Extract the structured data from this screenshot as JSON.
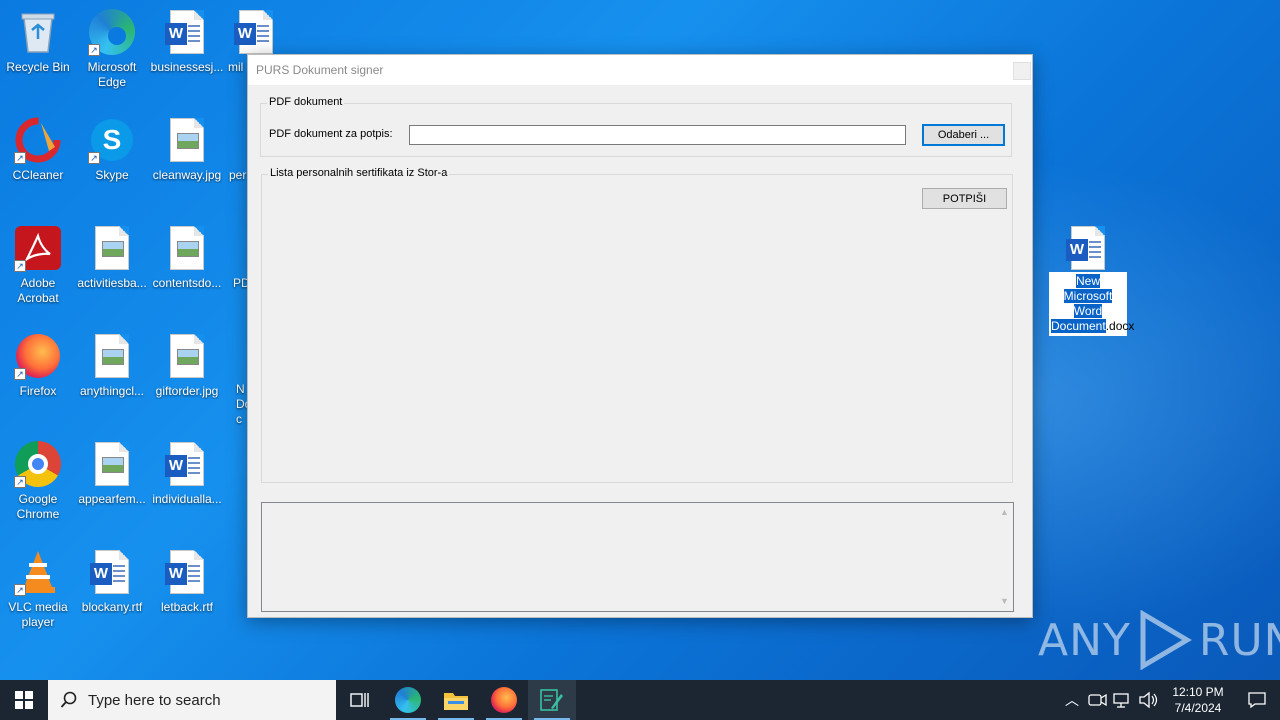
{
  "desktop": {
    "icons": [
      {
        "label": "Recycle Bin",
        "icon": "recycle-bin-icon"
      },
      {
        "label": "Microsoft Edge",
        "icon": "edge-icon"
      },
      {
        "label": "businessesj...",
        "icon": "word-doc-icon"
      },
      {
        "label": "mil",
        "icon": "word-doc-icon"
      },
      {
        "label": "CCleaner",
        "icon": "ccleaner-icon"
      },
      {
        "label": "Skype",
        "icon": "skype-icon"
      },
      {
        "label": "cleanway.jpg",
        "icon": "image-file-icon"
      },
      {
        "label": "per",
        "icon": "word-doc-icon"
      },
      {
        "label": "Adobe Acrobat",
        "icon": "acrobat-icon"
      },
      {
        "label": "activitiesba...",
        "icon": "image-file-icon"
      },
      {
        "label": "contentsdo...",
        "icon": "image-file-icon"
      },
      {
        "label": "PD",
        "icon": "pdf-icon"
      },
      {
        "label": "Firefox",
        "icon": "firefox-icon"
      },
      {
        "label": "anythingcl...",
        "icon": "image-file-icon"
      },
      {
        "label": "giftorder.jpg",
        "icon": "image-file-icon"
      },
      {
        "label": "N Doc",
        "icon": "word-doc-icon"
      },
      {
        "label": "Google Chrome",
        "icon": "chrome-icon"
      },
      {
        "label": "appearfem...",
        "icon": "image-file-icon"
      },
      {
        "label": "individualla...",
        "icon": "word-doc-icon"
      },
      {
        "label": "VLC media player",
        "icon": "vlc-icon"
      },
      {
        "label": "blockany.rtf",
        "icon": "word-doc-icon"
      },
      {
        "label": "letback.rtf",
        "icon": "word-doc-icon"
      }
    ],
    "selected_icon": {
      "label_highlight": "New Microsoft Word Document",
      "label_rest": ".docx",
      "icon": "word-doc-icon"
    }
  },
  "window": {
    "title": "PURS Dokument signer",
    "group_pdf": {
      "legend": "PDF dokument",
      "field_label": "PDF dokument za potpis:",
      "field_value": "",
      "browse_button": "Odaberi ..."
    },
    "group_certs": {
      "legend": "Lista personalnih sertifikata iz Stor-a",
      "sign_button": "POTPIŠI"
    },
    "log": {
      "text": ""
    }
  },
  "watermark": {
    "text_left": "ANY",
    "text_right": "RUN"
  },
  "taskbar": {
    "search_placeholder": "Type here to search",
    "time": "12:10 PM",
    "date": "7/4/2024",
    "pinned": [
      "task-view-icon",
      "edge-icon",
      "file-explorer-icon",
      "firefox-icon",
      "signer-app-icon"
    ],
    "accent": "#76b9ed"
  }
}
